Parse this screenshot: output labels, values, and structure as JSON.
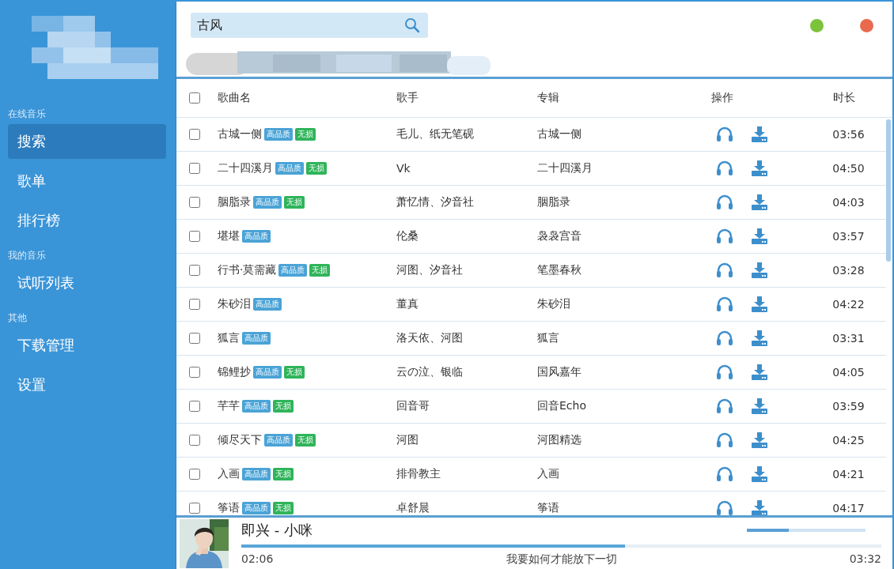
{
  "sidebar": {
    "sections": [
      {
        "title": "在线音乐",
        "items": [
          {
            "label": "搜索",
            "selected": true
          },
          {
            "label": "歌单",
            "selected": false
          },
          {
            "label": "排行榜",
            "selected": false
          }
        ]
      },
      {
        "title": "我的音乐",
        "items": [
          {
            "label": "试听列表",
            "selected": false
          }
        ]
      },
      {
        "title": "其他",
        "items": [
          {
            "label": "下载管理",
            "selected": false
          },
          {
            "label": "设置",
            "selected": false
          }
        ]
      }
    ]
  },
  "search": {
    "value": "古风"
  },
  "window_controls": [
    {
      "color": "#7cc23a"
    },
    {
      "color": "#e9694f"
    }
  ],
  "table": {
    "all_checked": false,
    "columns": [
      "歌曲名",
      "歌手",
      "专辑",
      "操作",
      "时长"
    ],
    "rows": [
      {
        "checked": false,
        "name": "古城一侧",
        "tags": [
          {
            "kind": "hq",
            "label": "高品质"
          },
          {
            "kind": "lossless",
            "label": "无损"
          }
        ],
        "artist": "毛儿、纸无笔砚",
        "album": "古城一侧",
        "duration": "03:56"
      },
      {
        "checked": false,
        "name": "二十四溪月",
        "tags": [
          {
            "kind": "hq",
            "label": "高品质"
          },
          {
            "kind": "lossless",
            "label": "无损"
          }
        ],
        "artist": "Vk",
        "album": "二十四溪月",
        "duration": "04:50"
      },
      {
        "checked": false,
        "name": "胭脂录",
        "tags": [
          {
            "kind": "hq",
            "label": "高品质"
          },
          {
            "kind": "lossless",
            "label": "无损"
          }
        ],
        "artist": "萧忆情、汐音社",
        "album": "胭脂录",
        "duration": "04:03"
      },
      {
        "checked": false,
        "name": "堪堪",
        "tags": [
          {
            "kind": "hq",
            "label": "高品质"
          }
        ],
        "artist": "伦桑",
        "album": "袅袅宫音",
        "duration": "03:57"
      },
      {
        "checked": false,
        "name": "行书·莫需藏",
        "tags": [
          {
            "kind": "hq",
            "label": "高品质"
          },
          {
            "kind": "lossless",
            "label": "无损"
          }
        ],
        "artist": "河图、汐音社",
        "album": "笔墨春秋",
        "duration": "03:28"
      },
      {
        "checked": false,
        "name": "朱砂泪",
        "tags": [
          {
            "kind": "hq",
            "label": "高品质"
          }
        ],
        "artist": "董真",
        "album": "朱砂泪",
        "duration": "04:22"
      },
      {
        "checked": false,
        "name": "狐言",
        "tags": [
          {
            "kind": "hq",
            "label": "高品质"
          }
        ],
        "artist": "洛天依、河图",
        "album": "狐言",
        "duration": "03:31"
      },
      {
        "checked": false,
        "name": "锦鲤抄",
        "tags": [
          {
            "kind": "hq",
            "label": "高品质"
          },
          {
            "kind": "lossless",
            "label": "无损"
          }
        ],
        "artist": "云の泣、银临",
        "album": "国风嘉年",
        "duration": "04:05"
      },
      {
        "checked": false,
        "name": "芊芊",
        "tags": [
          {
            "kind": "hq",
            "label": "高品质"
          },
          {
            "kind": "lossless",
            "label": "无损"
          }
        ],
        "artist": "回音哥",
        "album": "回音Echo",
        "duration": "03:59"
      },
      {
        "checked": false,
        "name": "倾尽天下",
        "tags": [
          {
            "kind": "hq",
            "label": "高品质"
          },
          {
            "kind": "lossless",
            "label": "无损"
          }
        ],
        "artist": "河图",
        "album": "河图精选",
        "duration": "04:25"
      },
      {
        "checked": false,
        "name": "入画",
        "tags": [
          {
            "kind": "hq",
            "label": "高品质"
          },
          {
            "kind": "lossless",
            "label": "无损"
          }
        ],
        "artist": "排骨教主",
        "album": "入画",
        "duration": "04:21"
      },
      {
        "checked": false,
        "name": "筝语",
        "tags": [
          {
            "kind": "hq",
            "label": "高品质"
          },
          {
            "kind": "lossless",
            "label": "无损"
          }
        ],
        "artist": "卓舒晨",
        "album": "筝语",
        "duration": "04:17"
      }
    ]
  },
  "player": {
    "title": "即兴 - 小咪",
    "elapsed": "02:06",
    "lyric": "我要如何才能放下一切",
    "total": "03:32",
    "level": 0.6,
    "volume": {
      "level": 0.35
    }
  }
}
